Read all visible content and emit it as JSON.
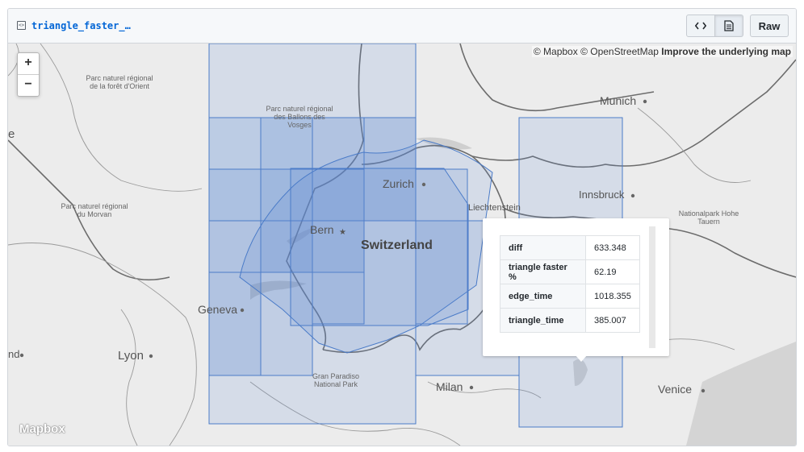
{
  "file": {
    "title": "triangle_faster_…",
    "raw_label": "Raw",
    "code_icon": "code-icon",
    "doc_icon": "document-icon"
  },
  "map": {
    "attribution": {
      "mapbox": "© Mapbox",
      "osm": "© OpenStreetMap",
      "improve": "Improve the underlying map"
    },
    "logo": "Mapbox",
    "zoom_in": "+",
    "zoom_out": "−",
    "cities": [
      "Munich",
      "Innsbruck",
      "Zurich",
      "Bern",
      "Geneva",
      "Lyon",
      "Milan",
      "Venice",
      "Liechtenstein",
      "nd",
      "e"
    ],
    "country": "Switzerland",
    "parks": {
      "foret_orient": [
        "Parc naturel régional",
        "de la forêt d'Orient"
      ],
      "ballons_vosges": [
        "Parc naturel régional",
        "des Ballons des",
        "Vosges"
      ],
      "morvan": [
        "Parc naturel régional",
        "du Morvan"
      ],
      "hohe_tauern": [
        "Nationalpark Hohe",
        "Tauern"
      ],
      "gran_paradiso": [
        "Gran Paradiso",
        "National Park"
      ]
    },
    "colors": {
      "fill": "#5b8bd6",
      "stroke": "#4a7bc8",
      "background": "#ececec"
    }
  },
  "popup": {
    "rows": [
      {
        "key": "diff",
        "value": "633.348"
      },
      {
        "key": "triangle faster %",
        "value": "62.19"
      },
      {
        "key": "edge_time",
        "value": "1018.355"
      },
      {
        "key": "triangle_time",
        "value": "385.007"
      }
    ]
  }
}
